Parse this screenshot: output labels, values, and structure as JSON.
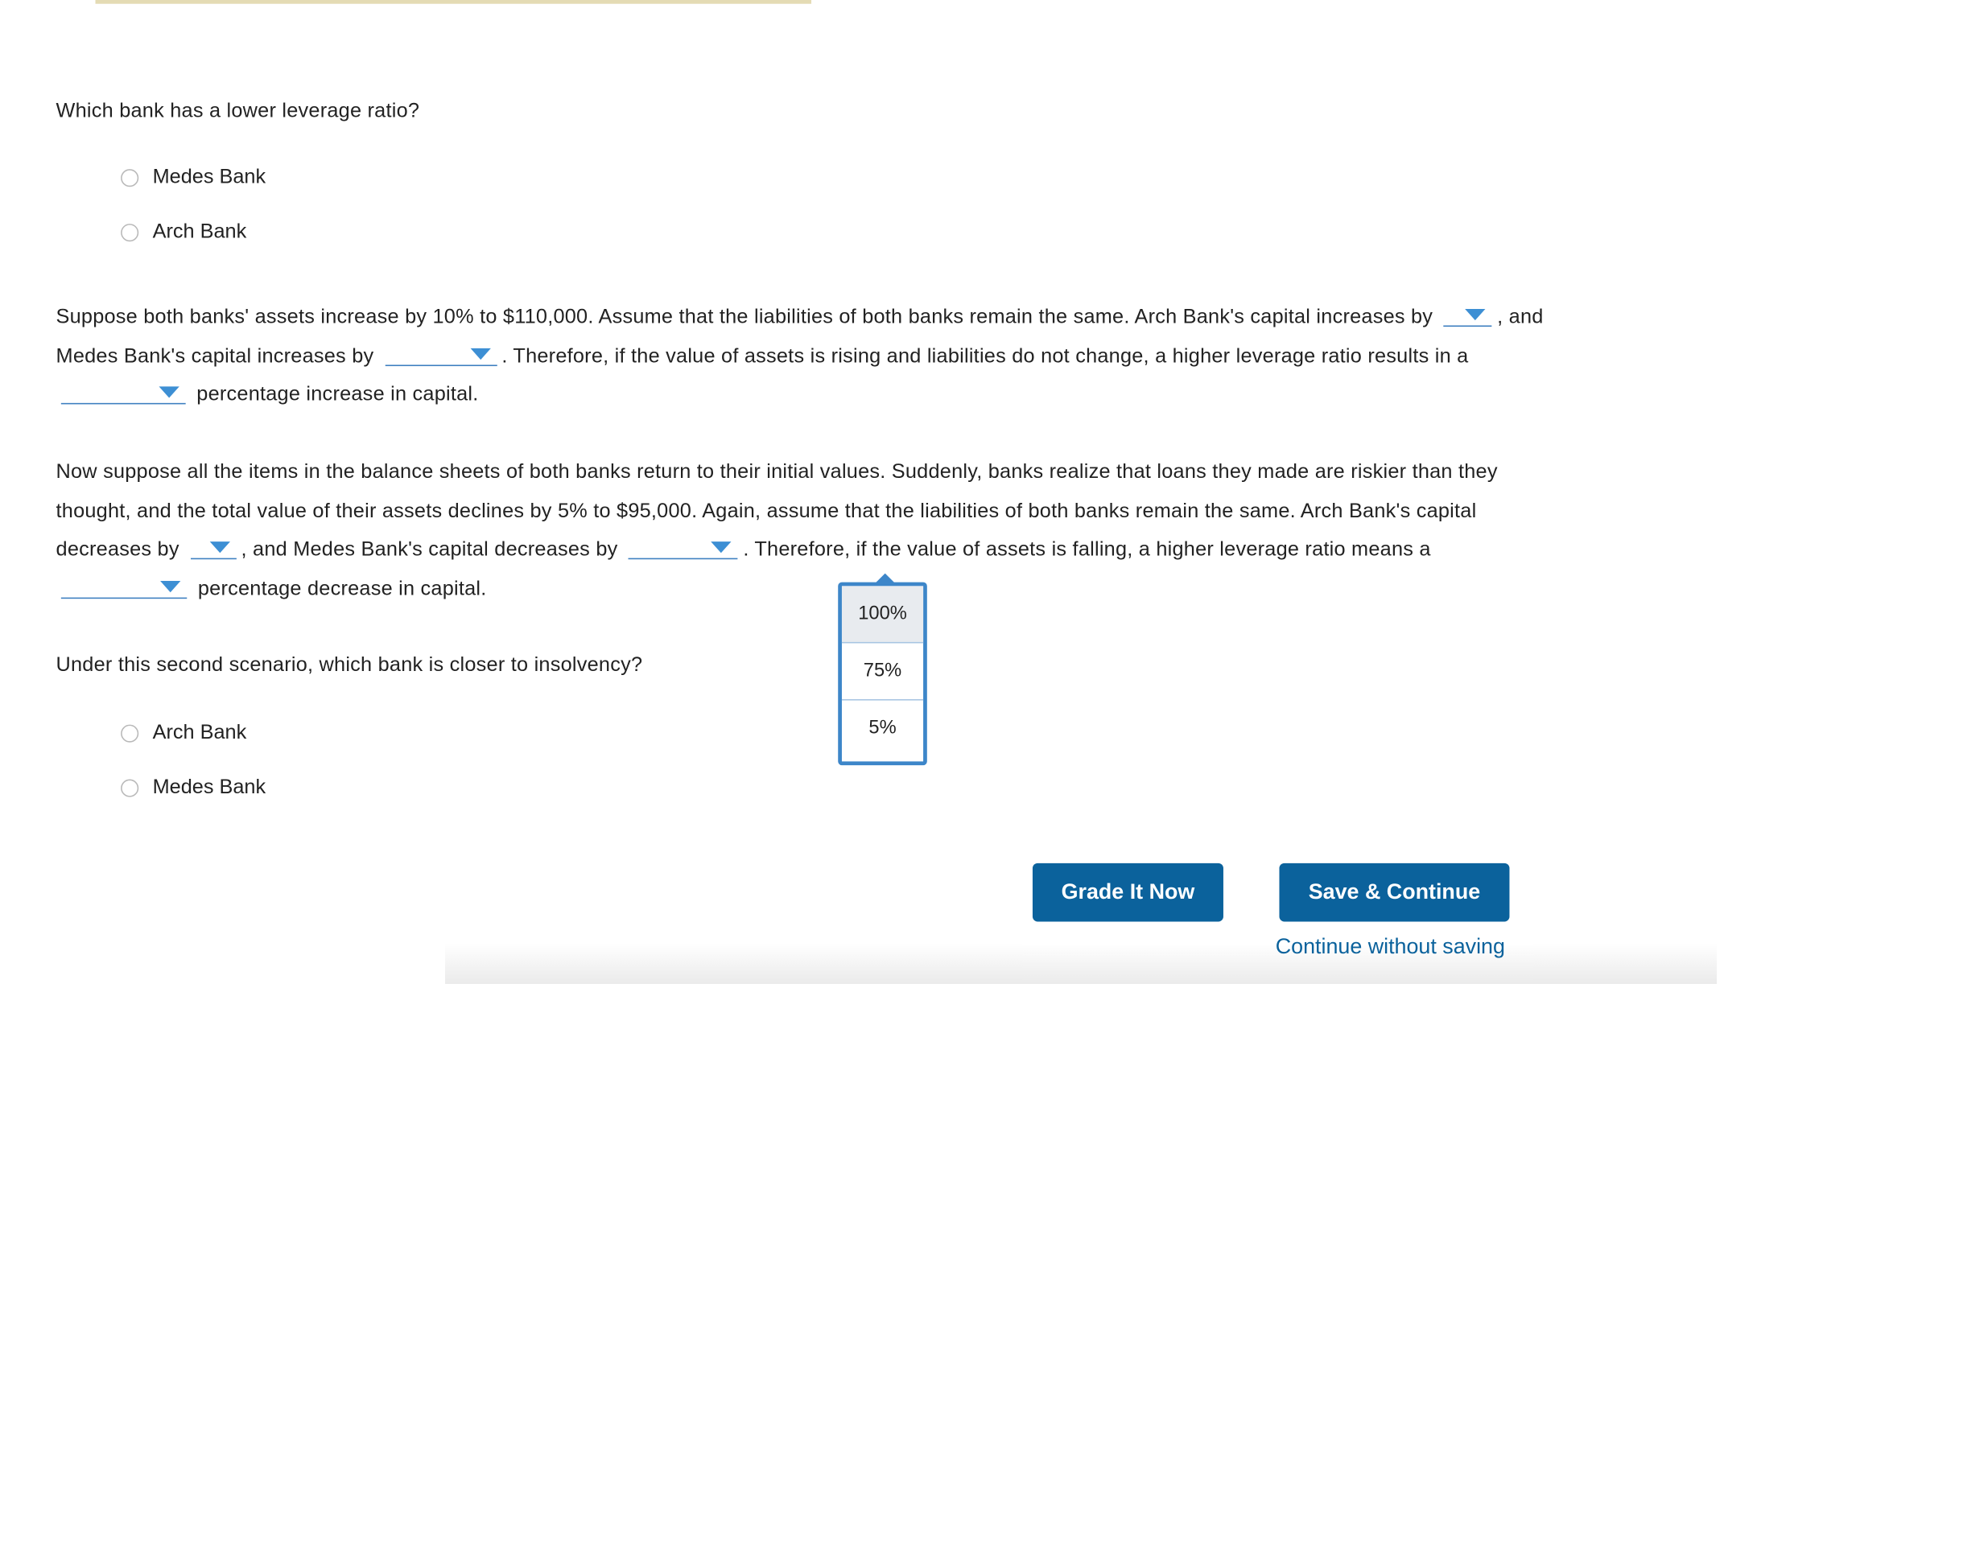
{
  "question1": {
    "prompt": "Which bank has a lower leverage ratio?",
    "options": [
      "Medes Bank",
      "Arch Bank"
    ]
  },
  "scenario1": {
    "text_a": "Suppose both banks' assets increase by 10% to $110,000. Assume that the liabilities of both banks remain the same. Arch Bank's capital increases by",
    "text_b": ", and Medes Bank's capital increases by",
    "text_c": ". Therefore, if the value of assets is rising and liabilities do not change, a higher leverage ratio results in a",
    "text_d": "percentage increase in capital."
  },
  "scenario2": {
    "text_a": "Now suppose all the items in the balance sheets of both banks return to their initial values. Suddenly, banks realize that loans they made are riskier than they thought, and the total value of their assets declines by 5% to $95,000. Again, assume that the liabilities of both banks remain the same. Arch Bank's capital decreases by",
    "text_b": ", and Medes Bank's capital decreases by",
    "text_c": ". Therefore, if the value of assets is falling, a higher leverage ratio means a",
    "text_d": "percentage decrease in capital."
  },
  "dropdown_menu": {
    "options": [
      "100%",
      "75%",
      "5%"
    ],
    "highlighted": "100%"
  },
  "question2": {
    "prompt": "Under this second scenario, which bank is closer to insolvency?",
    "options": [
      "Arch Bank",
      "Medes Bank"
    ]
  },
  "actions": {
    "grade": "Grade It Now",
    "save": "Save & Continue",
    "continue": "Continue without saving"
  }
}
